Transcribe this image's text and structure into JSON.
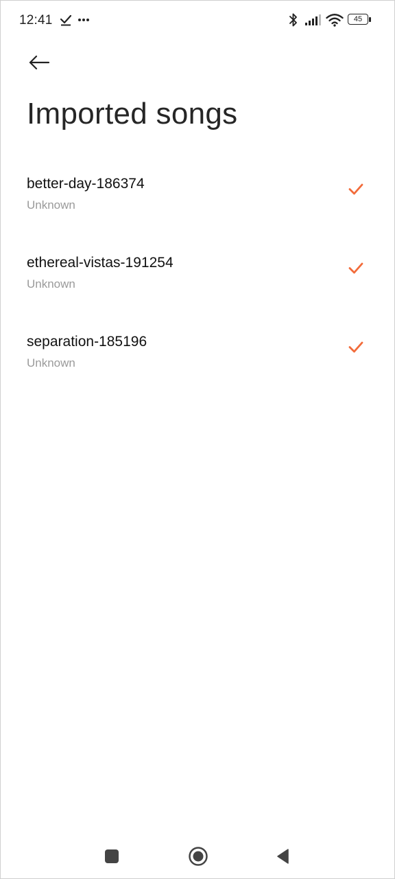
{
  "status_bar": {
    "time": "12:41",
    "battery_level": "45",
    "icons": [
      "download-done-icon",
      "more-dots-icon",
      "bluetooth-icon",
      "signal-icon",
      "wifi-icon",
      "battery-icon"
    ]
  },
  "header": {
    "back_icon": "arrow-left-icon",
    "title": "Imported songs"
  },
  "songs": [
    {
      "title": "better-day-186374",
      "artist": "Unknown",
      "selected": true
    },
    {
      "title": "ethereal-vistas-191254",
      "artist": "Unknown",
      "selected": true
    },
    {
      "title": "separation-185196",
      "artist": "Unknown",
      "selected": true
    }
  ],
  "colors": {
    "accent": "#f26b3a",
    "text_primary": "#111111",
    "text_secondary": "#9a9a9a"
  },
  "nav_bar": {
    "icons": [
      "recents-square-icon",
      "home-circle-icon",
      "back-triangle-icon"
    ]
  }
}
